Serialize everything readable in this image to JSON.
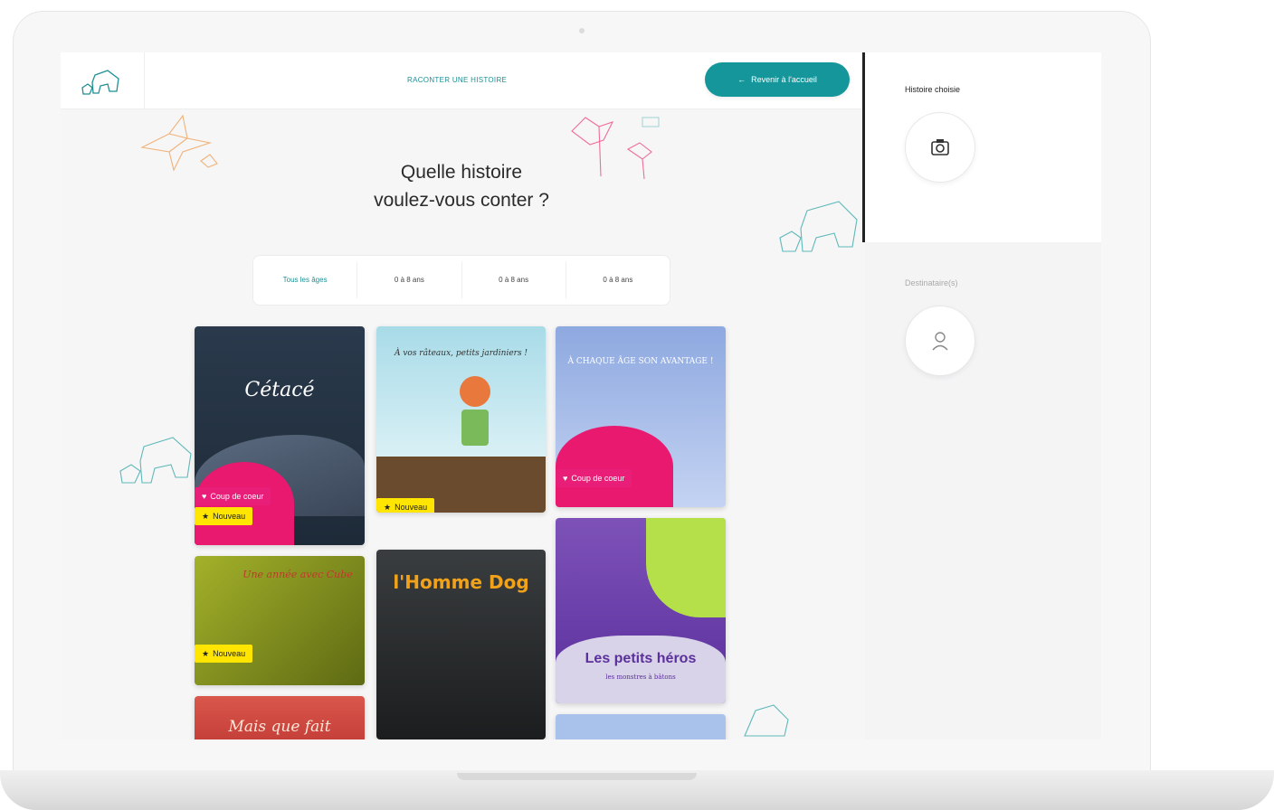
{
  "header": {
    "nav_title": "RACONTER UNE HISTOIRE",
    "home_button": "Revenir à l'accueil",
    "home_icon": "arrow-left-icon",
    "logo_icon": "elephant-logo-icon"
  },
  "main": {
    "title_line1": "Quelle histoire",
    "title_line2": "voulez-vous conter ?",
    "filters": [
      "Tous les âges",
      "0 à 8 ans",
      "0 à 8 ans",
      "0 à 8 ans"
    ]
  },
  "books": [
    {
      "title": "Cétacé",
      "badges": [
        "Coup de coeur",
        "Nouveau"
      ]
    },
    {
      "title": "À vos râteaux, petits jardiniers !",
      "badges": [
        "Nouveau"
      ]
    },
    {
      "title": "À CHAQUE ÂGE SON AVANTAGE !",
      "badges": [
        "Coup de coeur"
      ]
    },
    {
      "title": "Une année avec Cube",
      "badges": [
        "Nouveau"
      ]
    },
    {
      "title": "l'Homme Dog",
      "badges": []
    },
    {
      "title": "Les petits héros",
      "subtitle": "les monstres à bâtons",
      "badges": []
    },
    {
      "title": "Mais que fait",
      "badges": []
    }
  ],
  "sidebar": {
    "chosen_label": "Histoire choisie",
    "chosen_icon": "camera-icon",
    "recipients_label": "Destinataire(s)",
    "recipients_icon": "person-icon"
  },
  "colors": {
    "accent": "#15969a",
    "badge_pink": "#e91e78",
    "badge_yellow": "#ffe500"
  }
}
